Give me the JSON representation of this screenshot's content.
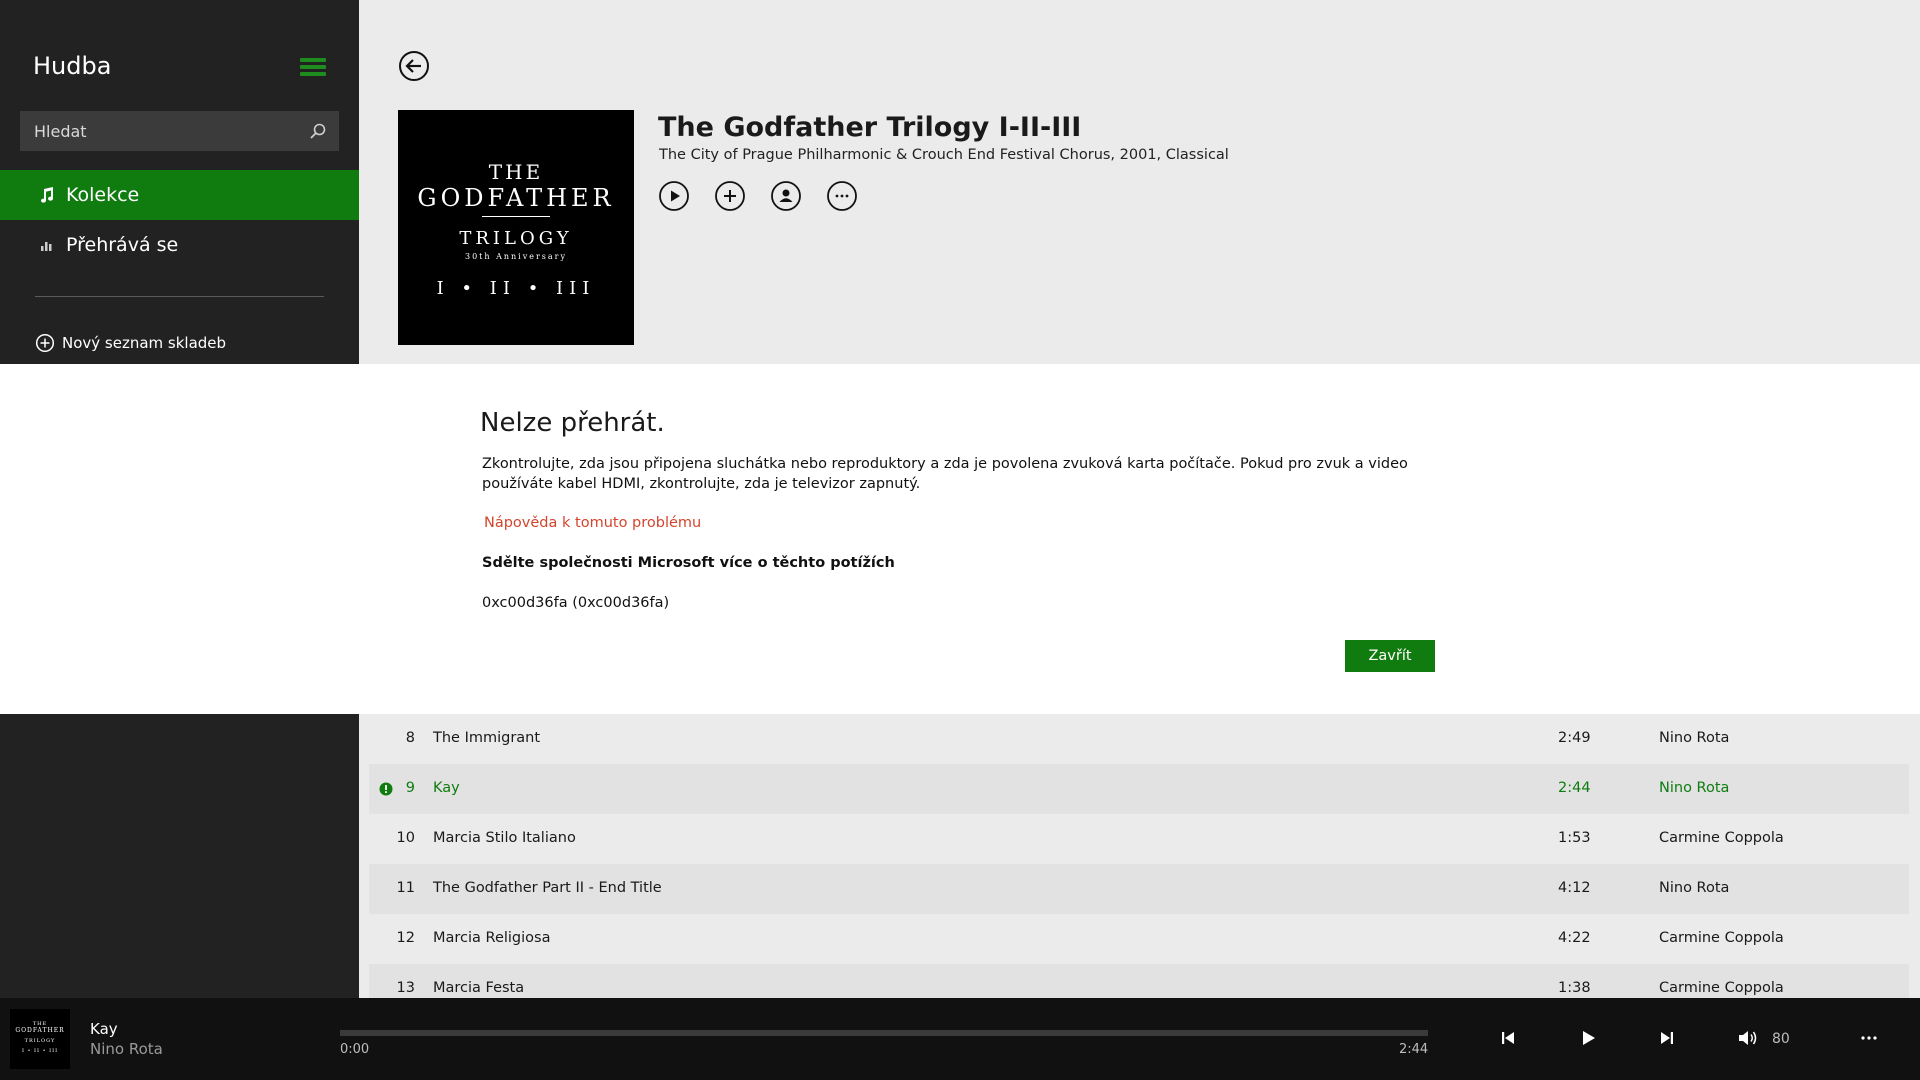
{
  "sidebar": {
    "app_title": "Hudba",
    "search_placeholder": "Hledat",
    "nav": [
      {
        "label": "Kolekce",
        "active": true
      },
      {
        "label": "Přehrává se",
        "active": false
      }
    ],
    "new_playlist_label": "Nový seznam skladeb"
  },
  "album": {
    "title": "The Godfather Trilogy I-II-III",
    "subtitle": "The City of Prague Philharmonic & Crouch End Festival Chorus, 2001, Classical",
    "art": {
      "line1": "THE",
      "line2": "GODFATHER",
      "line3": "TRILOGY",
      "line4": "30th Anniversary",
      "line5": "I • II • III"
    }
  },
  "dialog": {
    "title": "Nelze přehrát.",
    "message": "Zkontrolujte, zda jsou připojena sluchátka nebo reproduktory a zda je povolena zvuková karta počítače. Pokud pro zvuk a video používáte kabel HDMI, zkontrolujte, zda je televizor zapnutý.",
    "help_link": "Nápověda k tomuto problému",
    "feedback_link": "Sdělte společnosti Microsoft více o těchto potížích",
    "error_code": "0xc00d36fa (0xc00d36fa)",
    "close_label": "Zavřít"
  },
  "tracks": [
    {
      "num": "8",
      "title": "The Immigrant",
      "duration": "2:49",
      "artist": "Nino Rota"
    },
    {
      "num": "9",
      "title": "Kay",
      "duration": "2:44",
      "artist": "Nino Rota"
    },
    {
      "num": "10",
      "title": "Marcia Stilo Italiano",
      "duration": "1:53",
      "artist": "Carmine Coppola"
    },
    {
      "num": "11",
      "title": "The Godfather Part II - End Title",
      "duration": "4:12",
      "artist": "Nino Rota"
    },
    {
      "num": "12",
      "title": "Marcia Religiosa",
      "duration": "4:22",
      "artist": "Carmine Coppola"
    },
    {
      "num": "13",
      "title": "Marcia Festa",
      "duration": "1:38",
      "artist": "Carmine Coppola"
    }
  ],
  "player": {
    "title": "Kay",
    "artist": "Nino Rota",
    "time_current": "0:00",
    "time_total": "2:44",
    "progress": 0,
    "volume": "80",
    "mini_art": {
      "line1": "THE",
      "line2": "GODFATHER",
      "line3": "TRILOGY",
      "line4": "I • II • III"
    }
  },
  "colors": {
    "accent": "#107c10",
    "error_link": "#d2452c",
    "sidebar_bg": "#222222",
    "player_bg": "#111111"
  }
}
